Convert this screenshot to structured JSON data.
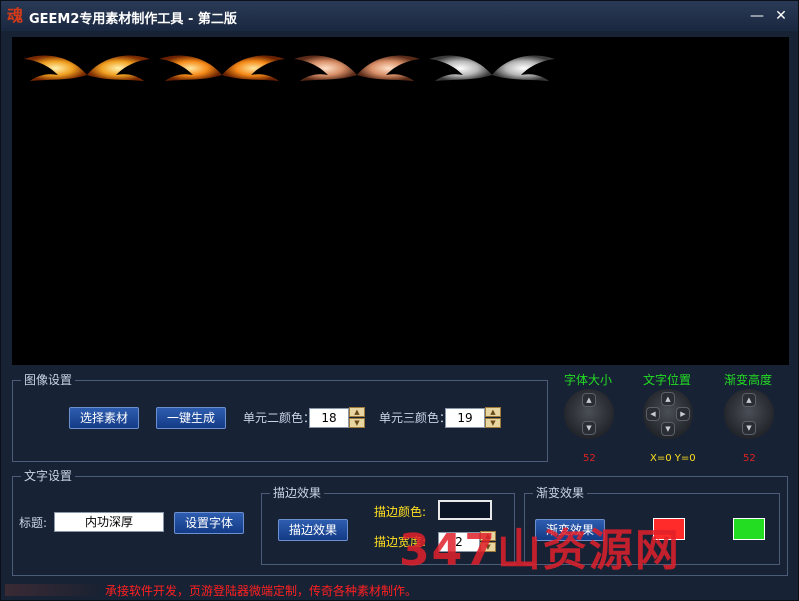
{
  "window": {
    "title": "GEEM2专用素材制作工具 - 第二版",
    "app_icon_glyph": "魂",
    "minimize_glyph": "—",
    "close_glyph": "✕"
  },
  "preview": {
    "background": "#000000",
    "wings": [
      {
        "name": "gold-wing",
        "color": "#f0a020"
      },
      {
        "name": "orange-wing",
        "color": "#f58a18"
      },
      {
        "name": "bronze-wing",
        "color": "#d89068"
      },
      {
        "name": "silver-wing",
        "color": "#b8b8b8"
      }
    ]
  },
  "image_settings": {
    "legend": "图像设置",
    "select_button": "选择素材",
    "generate_button": "一键生成",
    "unit2_label": "单元二颜色：",
    "unit2_value": "18",
    "unit3_label": "单元三颜色：",
    "unit3_value": "19"
  },
  "dials": {
    "font_size": {
      "label": "字体大小",
      "value": "52"
    },
    "text_pos": {
      "label": "文字位置",
      "value": "X=0 Y=0"
    },
    "gradient_height": {
      "label": "渐变高度",
      "value": "52"
    }
  },
  "text_settings": {
    "legend": "文字设置",
    "title_label": "标题:",
    "title_value": "内功深厚",
    "font_button": "设置字体"
  },
  "stroke": {
    "legend": "描边效果",
    "button": "描边效果",
    "color_label": "描边颜色:",
    "width_label": "描边宽度:",
    "width_value": "2"
  },
  "gradient": {
    "legend": "渐变效果",
    "button": "渐变效果"
  },
  "status_text": "承接软件开发，页游登陆器微端定制，传奇各种素材制作。",
  "watermark_text": "347山资源网",
  "colors": {
    "accent_blue": "#1f4aa0",
    "label_green": "#22dd22",
    "value_red": "#dd2222",
    "value_yellow": "#ffe020",
    "gradient_color1": "#ff2a2a",
    "gradient_color2": "#22dd22"
  }
}
